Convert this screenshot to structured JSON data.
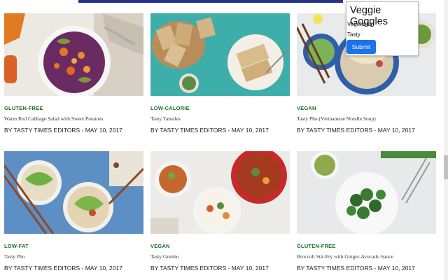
{
  "popup": {
    "title": "Veggie Goggles",
    "preference_label": "Vegetarian",
    "name_value": "Tasty",
    "submit_label": "Submit"
  },
  "recipes": [
    {
      "tag": "GLUTEN-FREE",
      "title": "Warm Red Cabbage Salad with Sweet Potatoes",
      "byline": "BY TASTY TIMES EDITORS - MAY 10, 2017"
    },
    {
      "tag": "LOW-CALORIE",
      "title": "Tasty Tamales",
      "byline": "BY TASTY TIMES EDITORS - MAY 10, 2017"
    },
    {
      "tag": "VEGAN",
      "title": "Tasty Pho (Vietnamese Noodle Soup)",
      "byline": "BY TASTY TIMES EDITORS - MAY 10, 2017"
    },
    {
      "tag": "LOW-FAT",
      "title": "Tasty Pho",
      "byline": "BY TASTY TIMES EDITORS - MAY 10, 2017"
    },
    {
      "tag": "VEGAN",
      "title": "Tasty Gumbo",
      "byline": "BY TASTY TIMES EDITORS - MAY 10, 2017"
    },
    {
      "tag": "GLUTEN-FREE",
      "title": "Broccoli Stir-Fry with Ginger-Avocado Sauce",
      "byline": "BY TASTY TIMES EDITORS - MAY 10, 2017"
    }
  ],
  "colors": {
    "tag_green": "#1f6b2a",
    "header_bar": "#26328a",
    "submit_blue": "#1a73e8"
  }
}
